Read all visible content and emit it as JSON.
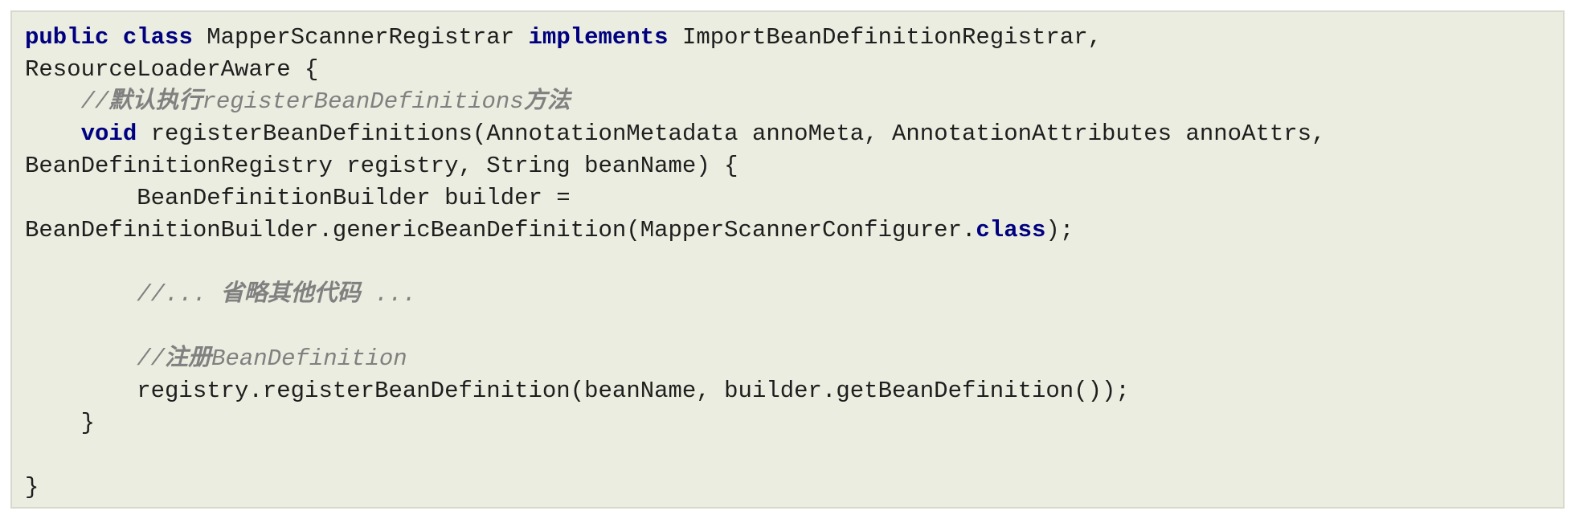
{
  "lines": [
    [
      {
        "t": "kw",
        "s": "public"
      },
      {
        "t": "plain",
        "s": " "
      },
      {
        "t": "kw",
        "s": "class"
      },
      {
        "t": "plain",
        "s": " MapperScannerRegistrar "
      },
      {
        "t": "kw",
        "s": "implements"
      },
      {
        "t": "plain",
        "s": " ImportBeanDefinitionRegistrar,"
      }
    ],
    [
      {
        "t": "plain",
        "s": "ResourceLoaderAware {"
      }
    ],
    [
      {
        "t": "plain",
        "s": "    "
      },
      {
        "t": "cm",
        "s": "//"
      },
      {
        "t": "cmcjk",
        "s": "默认执行"
      },
      {
        "t": "cm",
        "s": "registerBeanDefinitions"
      },
      {
        "t": "cmcjk",
        "s": "方法"
      }
    ],
    [
      {
        "t": "plain",
        "s": "    "
      },
      {
        "t": "kw",
        "s": "void"
      },
      {
        "t": "plain",
        "s": " registerBeanDefinitions(AnnotationMetadata annoMeta, AnnotationAttributes annoAttrs,"
      }
    ],
    [
      {
        "t": "plain",
        "s": "BeanDefinitionRegistry registry, String beanName) {"
      }
    ],
    [
      {
        "t": "plain",
        "s": "        BeanDefinitionBuilder builder ="
      }
    ],
    [
      {
        "t": "plain",
        "s": "BeanDefinitionBuilder.genericBeanDefinition(MapperScannerConfigurer."
      },
      {
        "t": "kw",
        "s": "class"
      },
      {
        "t": "plain",
        "s": ");"
      }
    ],
    [],
    [
      {
        "t": "plain",
        "s": "        "
      },
      {
        "t": "cm",
        "s": "//... "
      },
      {
        "t": "cmcjk",
        "s": "省略其他代码"
      },
      {
        "t": "cm",
        "s": " ..."
      }
    ],
    [],
    [
      {
        "t": "plain",
        "s": "        "
      },
      {
        "t": "cm",
        "s": "//"
      },
      {
        "t": "cmcjk",
        "s": "注册"
      },
      {
        "t": "cm",
        "s": "BeanDefinition"
      }
    ],
    [
      {
        "t": "plain",
        "s": "        registry.registerBeanDefinition(beanName, builder.getBeanDefinition());"
      }
    ],
    [
      {
        "t": "plain",
        "s": "    }"
      }
    ],
    [],
    [
      {
        "t": "plain",
        "s": "}"
      }
    ]
  ]
}
